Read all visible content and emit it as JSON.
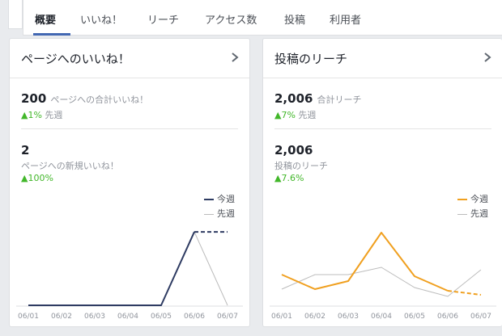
{
  "tabs": [
    {
      "label": "概要",
      "active": true
    },
    {
      "label": "いいね！"
    },
    {
      "label": "リーチ"
    },
    {
      "label": "アクセス数"
    },
    {
      "label": "投稿"
    },
    {
      "label": "利用者"
    }
  ],
  "colors": {
    "likes_this_week": "#2e3b62",
    "reach_this_week": "#f0a020",
    "last_week": "#bcbcbc",
    "positive": "#42b72a",
    "accent": "#4267b2"
  },
  "likes_card": {
    "title": "ページへのいいね！",
    "icon": "chevron-right-icon",
    "total_value": "200",
    "total_label": "ページへの合計いいね！",
    "total_change": "▲1%",
    "total_compare": "先週",
    "new_value": "2",
    "new_label": "ページへの新規いいね！",
    "new_change": "▲100%",
    "legend_this_week": "今週",
    "legend_last_week": "先週"
  },
  "reach_card": {
    "title": "投稿のリーチ",
    "icon": "chevron-right-icon",
    "total_value": "2,006",
    "total_label": "合計リーチ",
    "total_change": "▲7%",
    "total_compare": "先週",
    "post_value": "2,006",
    "post_label": "投稿のリーチ",
    "post_change": "▲7.6%",
    "legend_this_week": "今週",
    "legend_last_week": "先週"
  },
  "chart_data": [
    {
      "type": "line",
      "x": [
        "06/01",
        "06/02",
        "06/03",
        "06/04",
        "06/05",
        "06/06",
        "06/07"
      ],
      "series": [
        {
          "name": "今週",
          "values": [
            0,
            0,
            0,
            0,
            0,
            2,
            2
          ],
          "projected_last": true
        },
        {
          "name": "先週",
          "values": [
            0,
            0,
            0,
            0,
            0,
            2,
            0
          ]
        }
      ],
      "ylim": [
        0,
        2.2
      ]
    },
    {
      "type": "line",
      "x": [
        "06/01",
        "06/02",
        "06/03",
        "06/04",
        "06/05",
        "06/06",
        "06/07"
      ],
      "series": [
        {
          "name": "今週",
          "values": [
            380,
            200,
            300,
            900,
            360,
            180,
            130
          ],
          "projected_last": true
        },
        {
          "name": "先週",
          "values": [
            200,
            380,
            380,
            470,
            220,
            110,
            440
          ]
        }
      ],
      "ylim": [
        0,
        1000
      ]
    }
  ]
}
